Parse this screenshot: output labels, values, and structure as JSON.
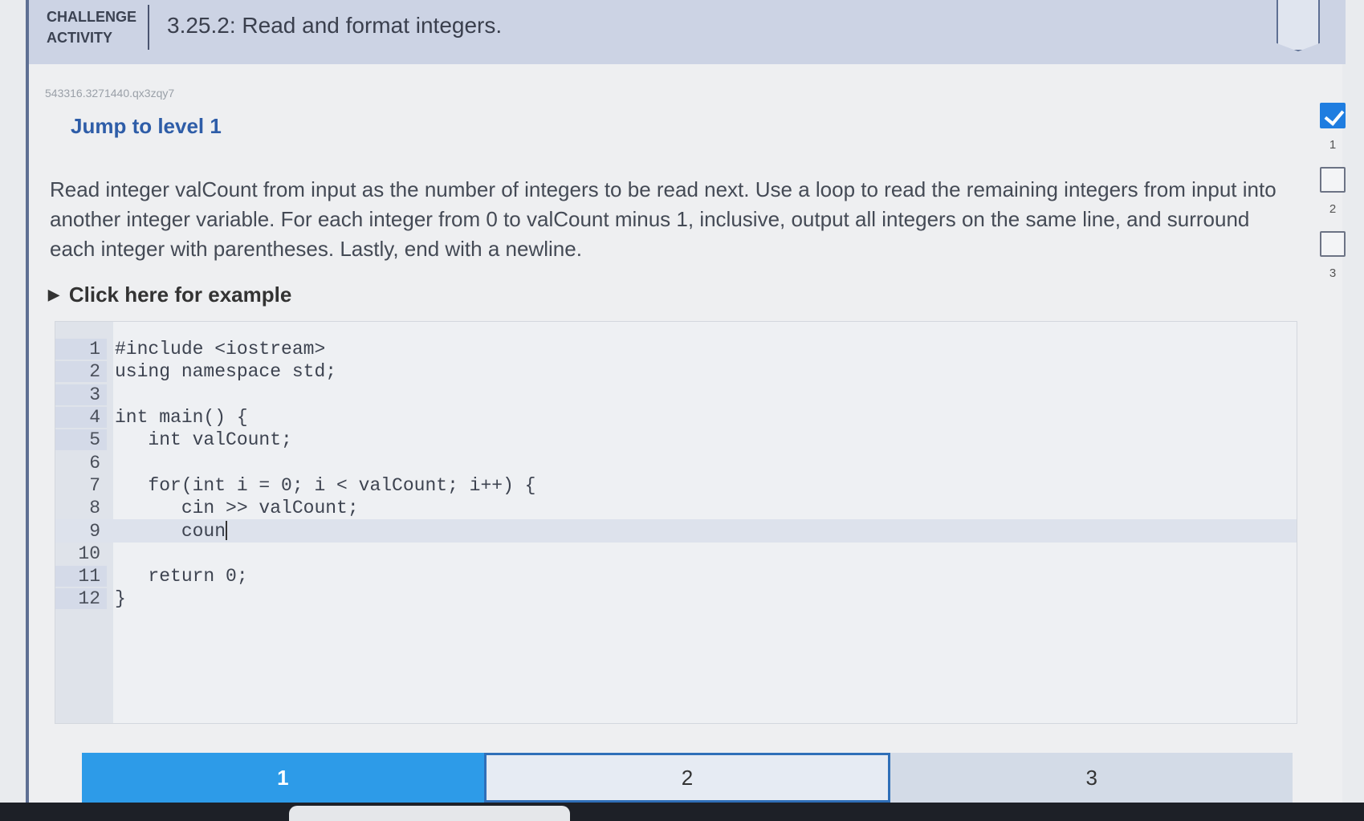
{
  "header": {
    "label_line1": "CHALLENGE",
    "label_line2": "ACTIVITY",
    "title": "3.25.2: Read and format integers."
  },
  "activity_id": "543316.3271440.qx3zqy7",
  "jump_level": "Jump to level 1",
  "instructions": "Read integer valCount from input as the number of integers to be read next. Use a loop to read the remaining integers from input into another integer variable. For each integer from 0 to valCount minus 1, inclusive, output all integers on the same line, and surround each integer with parentheses. Lastly, end with a newline.",
  "example_toggle": "Click here for example",
  "code": {
    "lines": [
      {
        "num": "1",
        "text": "#include <iostream>"
      },
      {
        "num": "2",
        "text": "using namespace std;"
      },
      {
        "num": "3",
        "text": ""
      },
      {
        "num": "4",
        "text": "int main() {"
      },
      {
        "num": "5",
        "text": "   int valCount;"
      },
      {
        "num": "6",
        "text": ""
      },
      {
        "num": "7",
        "text": "   for(int i = 0; i < valCount; i++) {"
      },
      {
        "num": "8",
        "text": "      cin >> valCount;"
      },
      {
        "num": "9",
        "text": "      coun"
      },
      {
        "num": "10",
        "text": ""
      },
      {
        "num": "11",
        "text": "   return 0;"
      },
      {
        "num": "12",
        "text": "}"
      }
    ]
  },
  "tabs": [
    {
      "label": "1"
    },
    {
      "label": "2"
    },
    {
      "label": "3"
    }
  ],
  "levels": [
    {
      "num": "1",
      "completed": true
    },
    {
      "num": "2",
      "completed": false
    },
    {
      "num": "3",
      "completed": false
    }
  ],
  "colors": {
    "accent": "#2d9be8",
    "header_bg": "#ccd3e4",
    "link": "#2e5da8"
  }
}
